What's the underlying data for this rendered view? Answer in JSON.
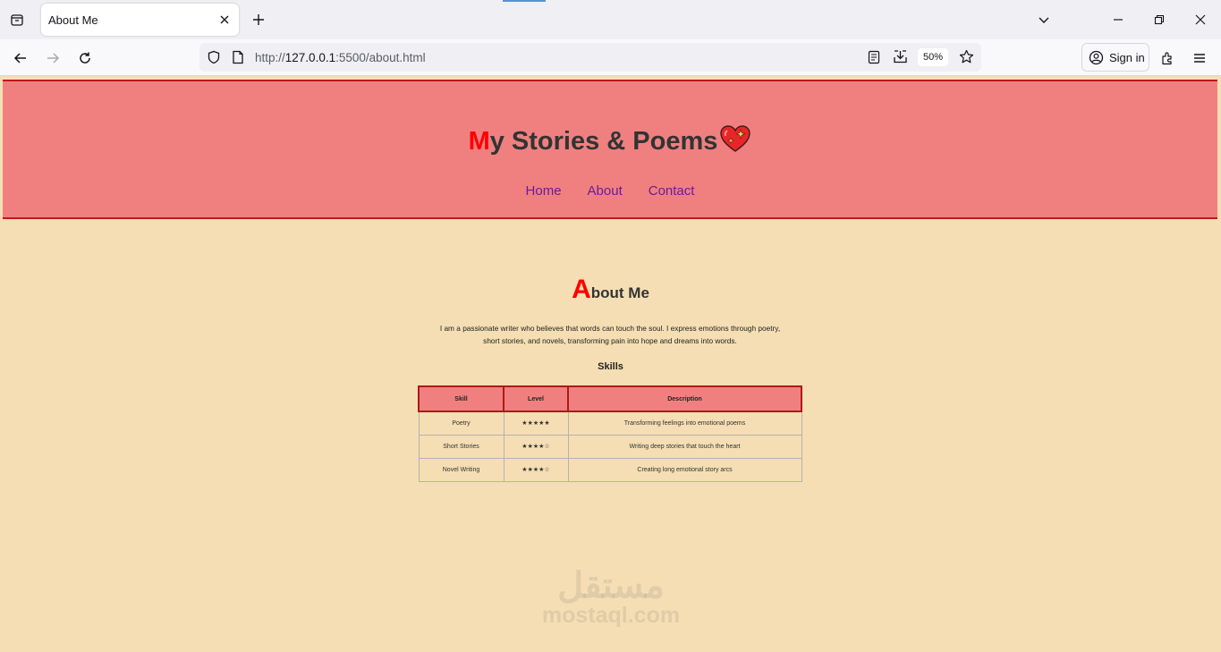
{
  "browser": {
    "tab_title": "About Me",
    "url_scheme": "http://",
    "url_host": "127.0.0.1",
    "url_rest": ":5500/about.html",
    "zoom": "50%",
    "signin_label": "Sign in"
  },
  "site": {
    "title_first_letter": "M",
    "title_rest": "y Stories & Poems",
    "nav": [
      "Home",
      "About",
      "Contact"
    ]
  },
  "about": {
    "title_first_letter": "A",
    "title_rest": "bout Me",
    "text": "I am a passionate writer who believes that words can touch the soul. I express emotions through poetry, short stories, and novels, transforming pain into hope and dreams into words.",
    "skills_title": "Skills",
    "table": {
      "headers": [
        "Skill",
        "Level",
        "Description"
      ],
      "rows": [
        [
          "Poetry",
          "★★★★★",
          "Transforming feelings into emotional poems"
        ],
        [
          "Short Stories",
          "★★★★☆",
          "Writing deep stories that touch the heart"
        ],
        [
          "Novel Writing",
          "★★★★☆",
          "Creating long emotional story arcs"
        ]
      ]
    }
  },
  "watermark": {
    "arabic": "مستقل",
    "latin": "mostaql.com"
  },
  "colors": {
    "header_bg": "#f08080",
    "page_bg": "#f5deb3",
    "accent_red": "#ff0000",
    "nav_link": "#6a1b9a"
  }
}
